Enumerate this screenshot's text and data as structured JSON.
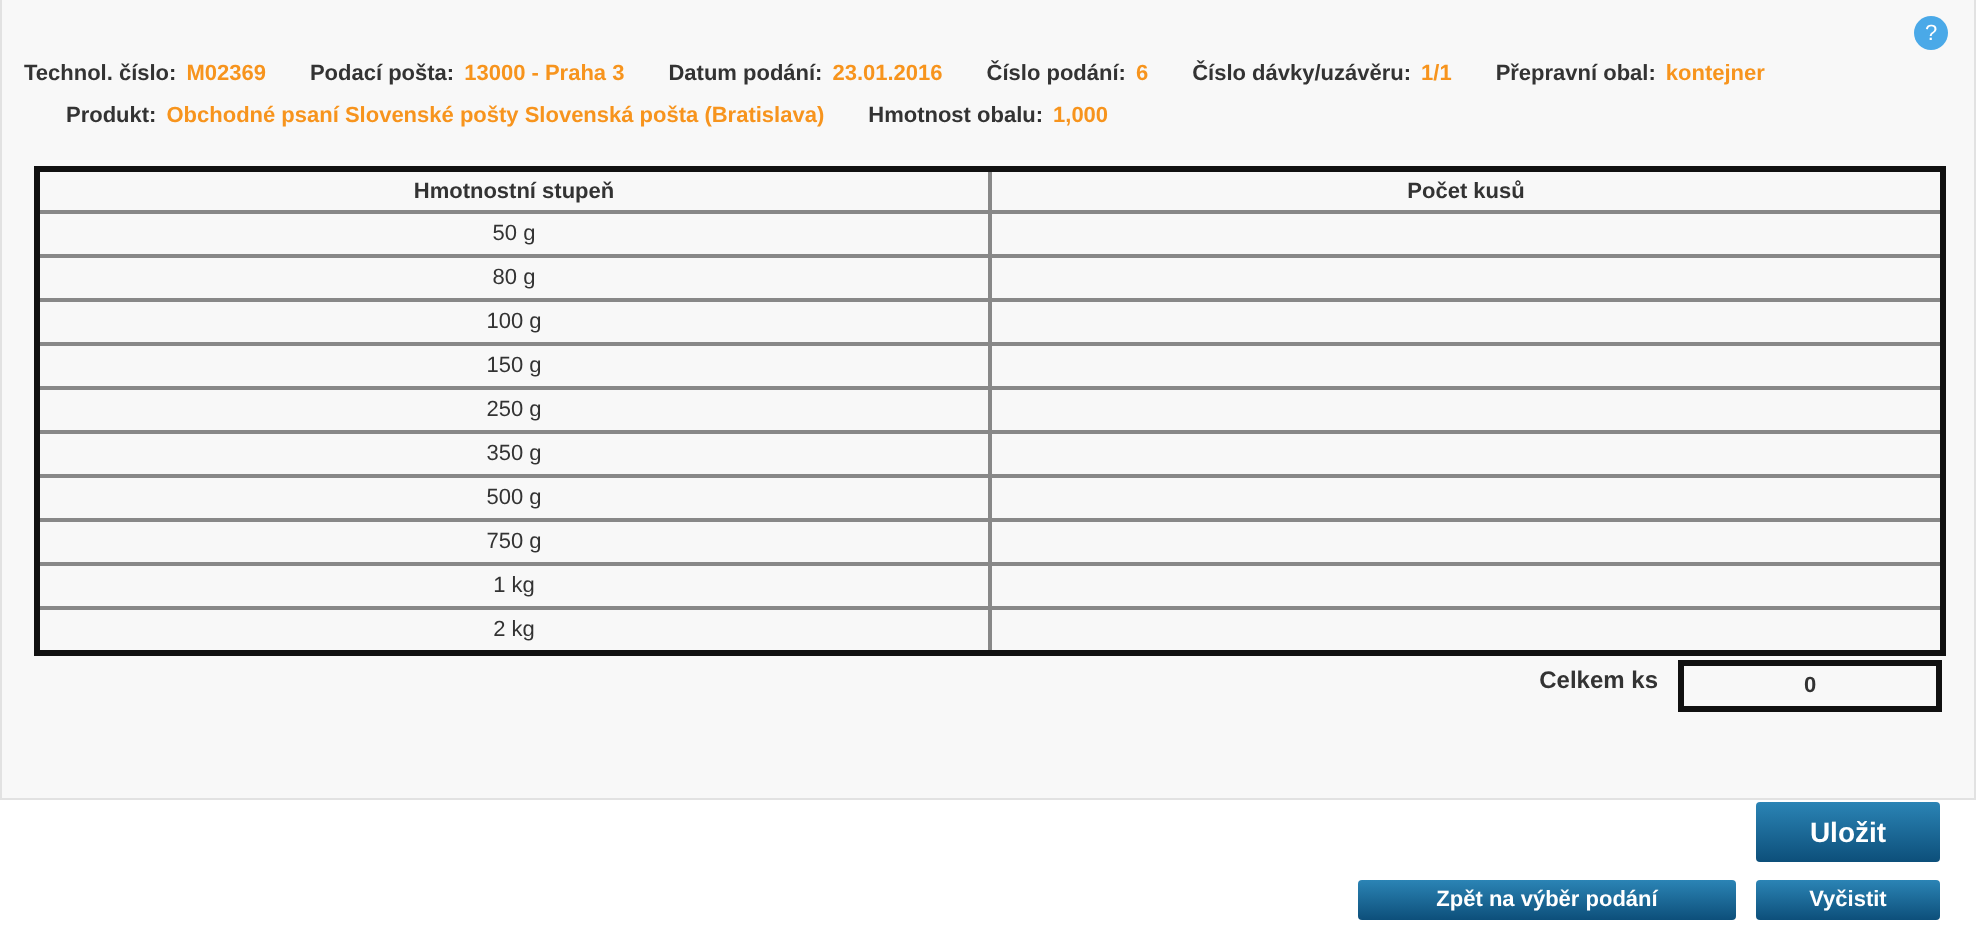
{
  "help_button": {
    "label": "?"
  },
  "info_lines": [
    [
      {
        "label": "Technol. číslo:",
        "value": "M02369"
      },
      {
        "label": "Podací pošta:",
        "value": "13000 - Praha 3"
      },
      {
        "label": "Datum podání:",
        "value": "23.01.2016"
      },
      {
        "label": "Číslo podání:",
        "value": "6"
      },
      {
        "label": "Číslo dávky/uzávěru:",
        "value": "1/1"
      },
      {
        "label": "Přepravní obal:",
        "value": "kontejner"
      }
    ],
    [
      {
        "label": "Produkt:",
        "value": "Obchodné psaní Slovenské pošty Slovenská pošta (Bratislava)"
      },
      {
        "label": "Hmotnost obalu:",
        "value": "1,000"
      }
    ]
  ],
  "table": {
    "columns": [
      "Hmotnostní stupeň",
      "Počet kusů"
    ],
    "rows": [
      {
        "weight": "50 g"
      },
      {
        "weight": "80 g"
      },
      {
        "weight": "100 g"
      },
      {
        "weight": "150 g"
      },
      {
        "weight": "250 g"
      },
      {
        "weight": "350 g"
      },
      {
        "weight": "500 g"
      },
      {
        "weight": "750 g"
      },
      {
        "weight": "1 kg"
      },
      {
        "weight": "2 kg"
      }
    ]
  },
  "total": {
    "label": "Celkem ks",
    "value": "0"
  },
  "buttons": [
    {
      "label": "Uložit",
      "kind": "primary"
    },
    {
      "label": "Zpět na výběr podání",
      "kind": "small"
    },
    {
      "label": "Vyčistit",
      "kind": "small"
    }
  ]
}
